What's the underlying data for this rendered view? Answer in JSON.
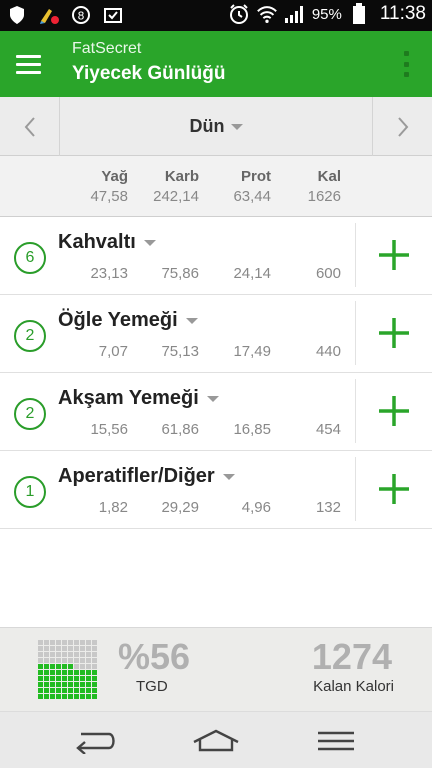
{
  "status_bar": {
    "battery_percent": "95%",
    "time": "11:38",
    "icons": [
      "shield-icon",
      "clean-app-icon",
      "notification-8-icon",
      "checklist-icon",
      "alarm-icon",
      "wifi-icon",
      "signal-icon",
      "battery-icon"
    ]
  },
  "app_bar": {
    "app_name": "FatSecret",
    "title": "Yiyecek Günlüğü",
    "menu_icon": "hamburger-icon",
    "overflow_icon": "overflow-menu-icon"
  },
  "date_nav": {
    "label": "Dün",
    "prev_icon": "chevron-left-icon",
    "next_icon": "chevron-right-icon"
  },
  "totals": {
    "headers": [
      "Yağ",
      "Karb",
      "Prot",
      "Kal"
    ],
    "values": [
      "47,58",
      "242,14",
      "63,44",
      "1626"
    ]
  },
  "meals": [
    {
      "count": "6",
      "name": "Kahvaltı",
      "values": [
        "23,13",
        "75,86",
        "24,14",
        "600"
      ]
    },
    {
      "count": "2",
      "name": "Öğle Yemeği",
      "values": [
        "7,07",
        "75,13",
        "17,49",
        "440"
      ]
    },
    {
      "count": "2",
      "name": "Akşam Yemeği",
      "values": [
        "15,56",
        "61,86",
        "16,85",
        "454"
      ]
    },
    {
      "count": "1",
      "name": "Aperatifler/Diğer",
      "values": [
        "1,82",
        "29,29",
        "4,96",
        "132"
      ]
    }
  ],
  "summary": {
    "rdi_percent": "%56",
    "rdi_label": "TGD",
    "rdi_fill_fraction": 0.56,
    "remaining_calories": "1274",
    "remaining_label": "Kalan Kalori"
  },
  "nav_bar": {
    "buttons": [
      "back-icon",
      "home-icon",
      "menu-icon"
    ]
  },
  "colors": {
    "accent": "#2aa52a",
    "accent_dark": "#1e7b1e",
    "rdi_filled": "#22bb22",
    "rdi_empty": "#c8c8c8"
  }
}
